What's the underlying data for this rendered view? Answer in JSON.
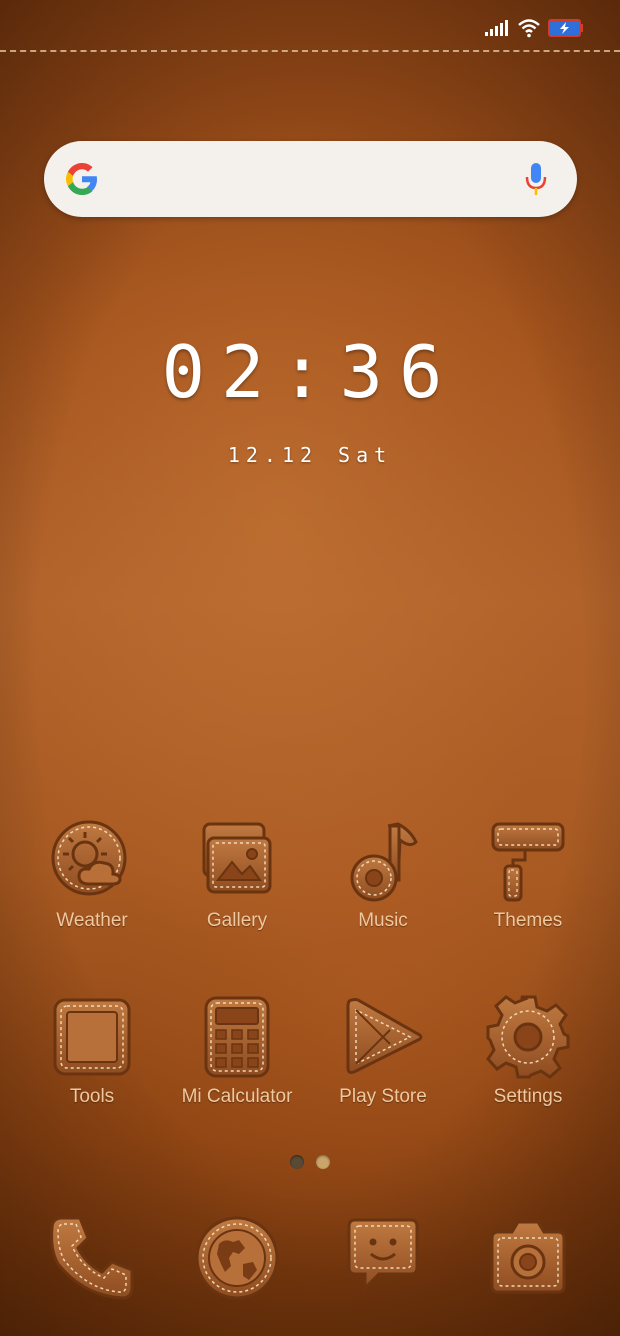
{
  "status_bar": {
    "icons": [
      "signal-icon",
      "wifi-icon",
      "battery-charging-icon"
    ]
  },
  "search_bar": {
    "logo": "google-g-logo",
    "mic_icon": "microphone-icon"
  },
  "clock": {
    "time": "02:36",
    "date": "12.12",
    "day": "Sat"
  },
  "apps": [
    {
      "label": "Weather",
      "icon": "weather-icon"
    },
    {
      "label": "Gallery",
      "icon": "gallery-icon"
    },
    {
      "label": "Music",
      "icon": "music-icon"
    },
    {
      "label": "Themes",
      "icon": "paint-roller-icon"
    },
    {
      "label": "Tools",
      "icon": "tools-icon"
    },
    {
      "label": "Mi Calculator",
      "icon": "calculator-icon"
    },
    {
      "label": "Play Store",
      "icon": "play-store-icon"
    },
    {
      "label": "Settings",
      "icon": "gear-icon"
    }
  ],
  "page_indicator": {
    "pages": 2,
    "current": 2
  },
  "dock": [
    {
      "icon": "phone-icon"
    },
    {
      "icon": "browser-globe-icon"
    },
    {
      "icon": "messages-icon"
    },
    {
      "icon": "camera-icon"
    }
  ],
  "colors": {
    "leather": "#a5541d",
    "icon_fill": "#b06a35",
    "icon_stitch": "#f0d8b4",
    "label": "#ecc9a0",
    "battery_fill": "#2e6fd9",
    "battery_border": "#d33a2c"
  }
}
